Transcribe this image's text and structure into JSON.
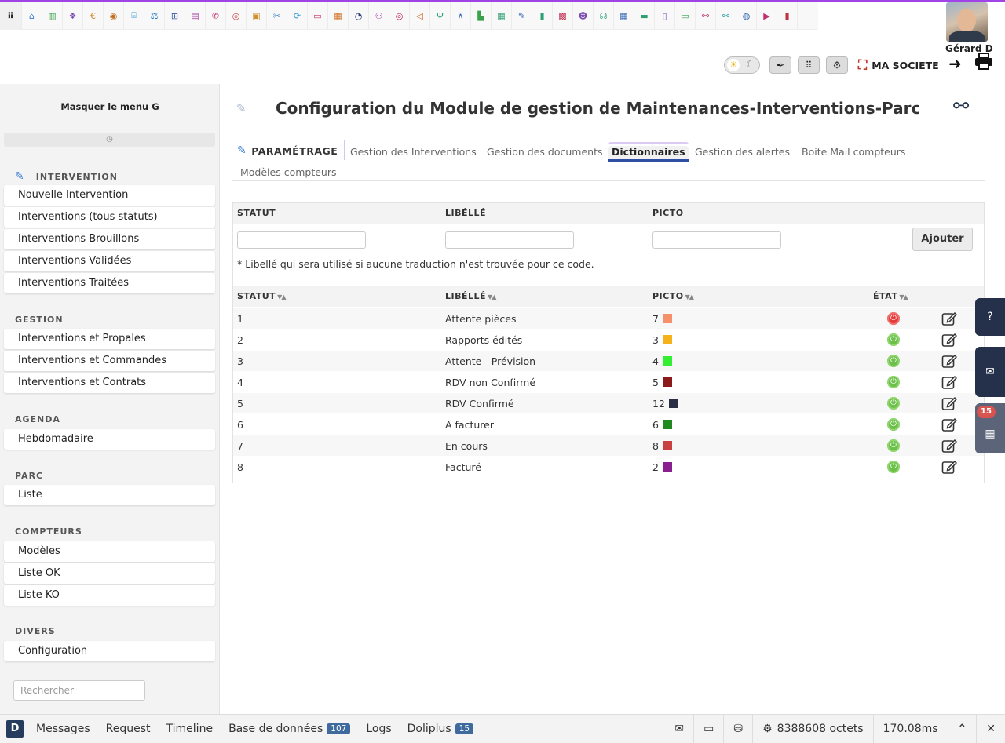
{
  "topbar": {
    "icons": [
      {
        "name": "apps-menu-icon",
        "glyph": "⠿",
        "color": "#222222"
      },
      {
        "name": "home-icon",
        "glyph": "⌂",
        "color": "#3a7bd5"
      },
      {
        "name": "building-icon",
        "glyph": "▥",
        "color": "#3aa24a"
      },
      {
        "name": "products-icon",
        "glyph": "❖",
        "color": "#7b4bb0"
      },
      {
        "name": "euro-icon",
        "glyph": "€",
        "color": "#d08a2c"
      },
      {
        "name": "coins-icon",
        "glyph": "◉",
        "color": "#c07020"
      },
      {
        "name": "bank-icon",
        "glyph": "⌸",
        "color": "#3a9ad0"
      },
      {
        "name": "scale-icon",
        "glyph": "⚖",
        "color": "#2c7bc0"
      },
      {
        "name": "sitemap-icon",
        "glyph": "⊞",
        "color": "#3a5ba0"
      },
      {
        "name": "chart-icon",
        "glyph": "▤",
        "color": "#a040a0"
      },
      {
        "name": "megaphone-icon",
        "glyph": "✆",
        "color": "#c03070"
      },
      {
        "name": "chrome-icon",
        "glyph": "◎",
        "color": "#c04040"
      },
      {
        "name": "briefcase-icon",
        "glyph": "▣",
        "color": "#d09030"
      },
      {
        "name": "tools-icon",
        "glyph": "✂",
        "color": "#2c7bc0"
      },
      {
        "name": "sync-icon",
        "glyph": "⟳",
        "color": "#2c9ad0"
      },
      {
        "name": "truck-icon",
        "glyph": "▭",
        "color": "#c03070"
      },
      {
        "name": "calendar-check-icon",
        "glyph": "▦",
        "color": "#d07020"
      },
      {
        "name": "clock-icon",
        "glyph": "◔",
        "color": "#2a3e7a"
      },
      {
        "name": "project-icon",
        "glyph": "⚇",
        "color": "#a040a0"
      },
      {
        "name": "target-icon",
        "glyph": "◎",
        "color": "#c02060"
      },
      {
        "name": "bullhorn-icon",
        "glyph": "◁",
        "color": "#d06020"
      },
      {
        "name": "antenna-icon",
        "glyph": "Ψ",
        "color": "#2ca070"
      },
      {
        "name": "road-icon",
        "glyph": "∧",
        "color": "#2a5fb0"
      },
      {
        "name": "industry-icon",
        "glyph": "▙",
        "color": "#3aa24a"
      },
      {
        "name": "spreadsheet-icon",
        "glyph": "▦",
        "color": "#2ca070"
      },
      {
        "name": "pencil-icon",
        "glyph": "✎",
        "color": "#2c5fb0"
      },
      {
        "name": "chip-icon",
        "glyph": "▮",
        "color": "#2ca070"
      },
      {
        "name": "cash-register-icon",
        "glyph": "▩",
        "color": "#c03050"
      },
      {
        "name": "users-icon",
        "glyph": "☻",
        "color": "#7b4bb0"
      },
      {
        "name": "headset-icon",
        "glyph": "☊",
        "color": "#2ca070"
      },
      {
        "name": "table-icon",
        "glyph": "▦",
        "color": "#2a5fb0"
      },
      {
        "name": "delivery-truck-icon",
        "glyph": "▬",
        "color": "#2ca070"
      },
      {
        "name": "file-icon",
        "glyph": "▯",
        "color": "#7b4bb0"
      },
      {
        "name": "folder-icon",
        "glyph": "▭",
        "color": "#3aa24a"
      },
      {
        "name": "handshake-icon",
        "glyph": "⚯",
        "color": "#c03070"
      },
      {
        "name": "handshake-alt-icon",
        "glyph": "⚯",
        "color": "#2ca0a0"
      },
      {
        "name": "chat-icon",
        "glyph": "◍",
        "color": "#2a5fb0"
      },
      {
        "name": "video-icon",
        "glyph": "▶",
        "color": "#c03070"
      },
      {
        "name": "book-icon",
        "glyph": "▮",
        "color": "#c03040"
      }
    ]
  },
  "user": {
    "name": "Gérard D"
  },
  "toolbar": {
    "company": "MA SOCIETE"
  },
  "sidebar": {
    "hide_menu": "Masquer le menu G",
    "search_placeholder": "Rechercher",
    "groups": [
      {
        "title": "INTERVENTION",
        "items": [
          "Nouvelle Intervention",
          "Interventions (tous statuts)",
          "Interventions Brouillons",
          "Interventions Validées",
          "Interventions Traitées"
        ]
      },
      {
        "title": "GESTION",
        "items": [
          "Interventions et Propales",
          "Interventions et Commandes",
          "Interventions et Contrats"
        ]
      },
      {
        "title": "AGENDA",
        "items": [
          "Hebdomadaire"
        ]
      },
      {
        "title": "PARC",
        "items": [
          "Liste"
        ]
      },
      {
        "title": "COMPTEURS",
        "items": [
          "Modèles",
          "Liste OK",
          "Liste KO"
        ]
      },
      {
        "title": "DIVERS",
        "items": [
          "Configuration"
        ]
      }
    ]
  },
  "page": {
    "title": "Configuration du Module de gestion de Maintenances-Interventions-Parc",
    "tabs": [
      {
        "label": "PARAMÉTRAGE",
        "active": false
      },
      {
        "label": "Gestion des Interventions",
        "active": false
      },
      {
        "label": "Gestion des documents",
        "active": false
      },
      {
        "label": "Dictionnaires",
        "active": true
      },
      {
        "label": "Gestion des alertes",
        "active": false
      },
      {
        "label": "Boite Mail compteurs",
        "active": false
      },
      {
        "label": "Modèles compteurs",
        "active": false
      }
    ]
  },
  "form": {
    "headers": [
      "STATUT",
      "LIBÉLLÉ",
      "PICTO"
    ],
    "add_button": "Ajouter",
    "note": "* Libellé qui sera utilisé si aucune traduction n'est trouvée pour ce code."
  },
  "list": {
    "headers": [
      "STATUT",
      "LIBÉLLÉ",
      "PICTO",
      "ÉTAT"
    ],
    "rows": [
      {
        "statut": "1",
        "libelle": "Attente pièces",
        "picto": "7",
        "color": "#f5906a",
        "etat": "off"
      },
      {
        "statut": "2",
        "libelle": "Rapports édités",
        "picto": "3",
        "color": "#f5b21b",
        "etat": "on"
      },
      {
        "statut": "3",
        "libelle": "Attente - Prévision",
        "picto": "4",
        "color": "#33ee33",
        "etat": "on"
      },
      {
        "statut": "4",
        "libelle": "RDV non Confirmé",
        "picto": "5",
        "color": "#8c1a1a",
        "etat": "on"
      },
      {
        "statut": "5",
        "libelle": "RDV Confirmé",
        "picto": "12",
        "color": "#2a2f45",
        "etat": "on"
      },
      {
        "statut": "6",
        "libelle": "A facturer",
        "picto": "6",
        "color": "#1f8a1f",
        "etat": "on"
      },
      {
        "statut": "7",
        "libelle": "En cours",
        "picto": "8",
        "color": "#c84040",
        "etat": "on"
      },
      {
        "statut": "8",
        "libelle": "Facturé",
        "picto": "2",
        "color": "#8a1f8f",
        "etat": "on"
      }
    ]
  },
  "right_panel": {
    "calendar_badge": "15"
  },
  "debugbar": {
    "logo": "D",
    "items": [
      {
        "label": "Messages"
      },
      {
        "label": "Request"
      },
      {
        "label": "Timeline"
      },
      {
        "label": "Base de données",
        "badge": "107"
      },
      {
        "label": "Logs"
      },
      {
        "label": "Doliplus",
        "badge": "15"
      }
    ],
    "memory": "8388608 octets",
    "time": "170.08ms"
  }
}
